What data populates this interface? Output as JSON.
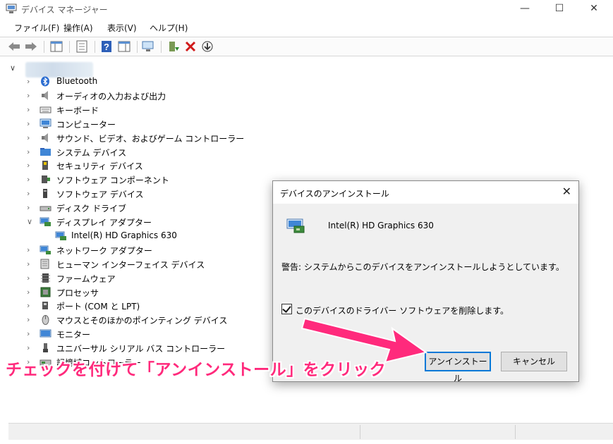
{
  "window": {
    "title": "デバイス マネージャー",
    "minimize": "—",
    "maximize": "☐",
    "close": "✕"
  },
  "menu": [
    "ファイル(F)",
    "操作(A)",
    "表示(V)",
    "ヘルプ(H)"
  ],
  "tree": {
    "expanded_char": "∨",
    "collapsed_char": "›",
    "items": [
      {
        "label": "Bluetooth",
        "icon": "bluetooth-icon",
        "expanded": false
      },
      {
        "label": "オーディオの入力および出力",
        "icon": "speaker-icon",
        "expanded": false
      },
      {
        "label": "キーボード",
        "icon": "keyboard-icon",
        "expanded": false
      },
      {
        "label": "コンピューター",
        "icon": "computer-icon",
        "expanded": false
      },
      {
        "label": "サウンド、ビデオ、およびゲーム コントローラー",
        "icon": "speaker-icon",
        "expanded": false
      },
      {
        "label": "システム デバイス",
        "icon": "system-folder-icon",
        "expanded": false
      },
      {
        "label": "セキュリティ デバイス",
        "icon": "security-key-icon",
        "expanded": false
      },
      {
        "label": "ソフトウェア コンポーネント",
        "icon": "software-component-icon",
        "expanded": false
      },
      {
        "label": "ソフトウェア デバイス",
        "icon": "software-device-icon",
        "expanded": false
      },
      {
        "label": "ディスク ドライブ",
        "icon": "disk-drive-icon",
        "expanded": false
      },
      {
        "label": "ディスプレイ アダプター",
        "icon": "display-adapter-icon",
        "expanded": true
      },
      {
        "label": "Intel(R) HD Graphics 630",
        "icon": "display-adapter-icon",
        "child": true
      },
      {
        "label": "ネットワーク アダプター",
        "icon": "network-icon",
        "expanded": false
      },
      {
        "label": "ヒューマン インターフェイス デバイス",
        "icon": "hid-icon",
        "expanded": false
      },
      {
        "label": "ファームウェア",
        "icon": "firmware-icon",
        "expanded": false
      },
      {
        "label": "プロセッサ",
        "icon": "processor-icon",
        "expanded": false
      },
      {
        "label": "ポート (COM と LPT)",
        "icon": "port-icon",
        "expanded": false
      },
      {
        "label": "マウスとそのほかのポインティング デバイス",
        "icon": "mouse-icon",
        "expanded": false
      },
      {
        "label": "モニター",
        "icon": "monitor-icon",
        "expanded": false
      },
      {
        "label": "ユニバーサル シリアル バス コントローラー",
        "icon": "usb-icon",
        "expanded": false
      },
      {
        "label": "記憶域コントローラー",
        "icon": "storage-controller-icon",
        "expanded": false
      }
    ]
  },
  "dialog": {
    "title": "デバイスのアンインストール",
    "close": "✕",
    "device_name": "Intel(R) HD Graphics 630",
    "warning": "警告: システムからこのデバイスをアンインストールしようとしています。",
    "checkbox_label": "このデバイスのドライバー ソフトウェアを削除します。",
    "checkbox_checked": true,
    "uninstall_button": "アンインストール",
    "cancel_button": "キャンセル"
  },
  "annotation": {
    "caption": "チェックを付けて「アンインストール」をクリック",
    "color": "#ff2a7c"
  },
  "colors": {
    "accent": "#0078d7",
    "annotation": "#ff2a7c"
  }
}
